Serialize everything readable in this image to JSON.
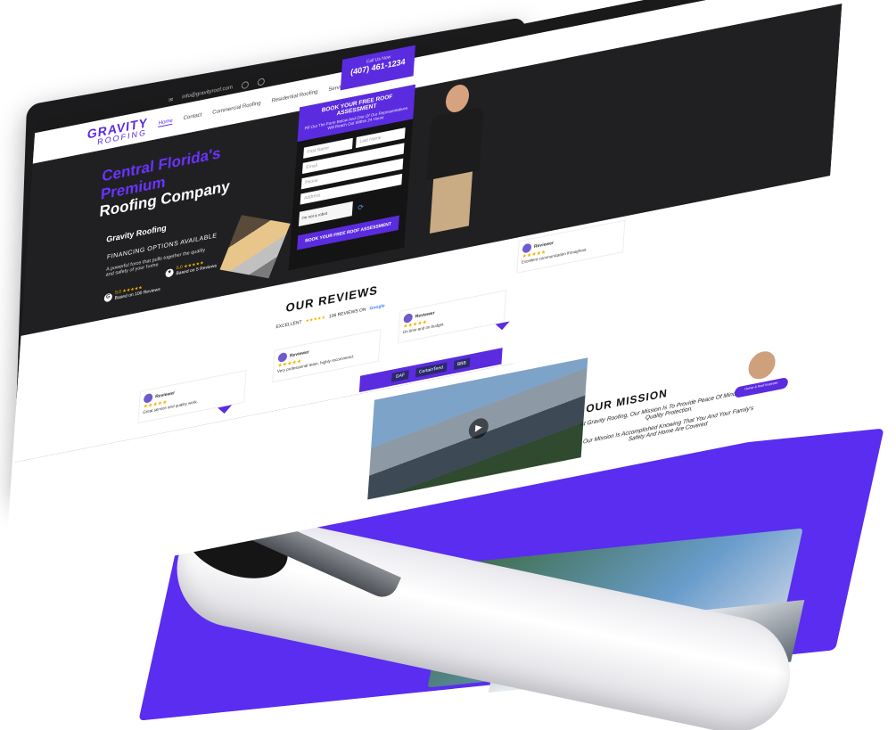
{
  "topbar": {
    "email": "info@gravityroof.com"
  },
  "nav": {
    "logo_line1": "GRAVITY",
    "logo_line2": "ROOFING",
    "items": [
      "Home",
      "Contact",
      "Commercial Roofing",
      "Residential Roofing",
      "Service Areas"
    ],
    "call_label": "Call Us Now",
    "phone": "(407) 461-1234"
  },
  "hero": {
    "title_line1": "Central Florida's",
    "title_line2": "Premium",
    "title_line3": "Roofing Company",
    "brand": "Gravity Roofing",
    "financing": "FINANCING OPTIONS AVAILABLE",
    "description": "A powerful force that pulls together the quality and safety of your home",
    "rating_google": "5.0 ★★★★★",
    "rating_google_sub": "Based on 100 Reviews",
    "rating_other": "5.0 ★★★★★",
    "rating_other_sub": "Based on 5 Reviews"
  },
  "form": {
    "title": "BOOK YOUR FREE ROOF ASSESSMENT",
    "subtitle": "Fill Out The Form Below And One Of Our Representatives Will Reach Out Within 24 Hours",
    "first_name": "First Name",
    "last_name": "Last Name",
    "email": "Email",
    "phone": "Phone",
    "address": "Address",
    "captcha": "I'm not a robot",
    "button": "BOOK YOUR FREE ROOF ASSESSMENT"
  },
  "reviews": {
    "heading": "OUR REVIEWS",
    "summary_label": "EXCELLENT",
    "summary_count": "106 REVIEWS ON",
    "summary_source": "Google",
    "cards": [
      {
        "name": "Reviewer",
        "text": "Great service and quality work."
      },
      {
        "name": "Reviewer",
        "text": "Very professional team, highly recommend."
      },
      {
        "name": "Reviewer",
        "text": "On time and on budget."
      },
      {
        "name": "Reviewer",
        "text": "Excellent communication throughout."
      }
    ],
    "badges": [
      "GAF",
      "CertainTeed",
      "BBB"
    ]
  },
  "mission": {
    "heading": "OUR MISSION",
    "line1": "At Gravity Roofing, Our Mission Is To Provide Peace Of Mind Through Quality Protection.",
    "line2": "Our Mission Is Accomplished Knowing That You And Your Family's Safety And Home Are Covered",
    "owner_tag": "Owner & Roof Inspector"
  },
  "colors": {
    "accent": "#5b2be0",
    "dark": "#202022",
    "star": "#f5b400"
  }
}
